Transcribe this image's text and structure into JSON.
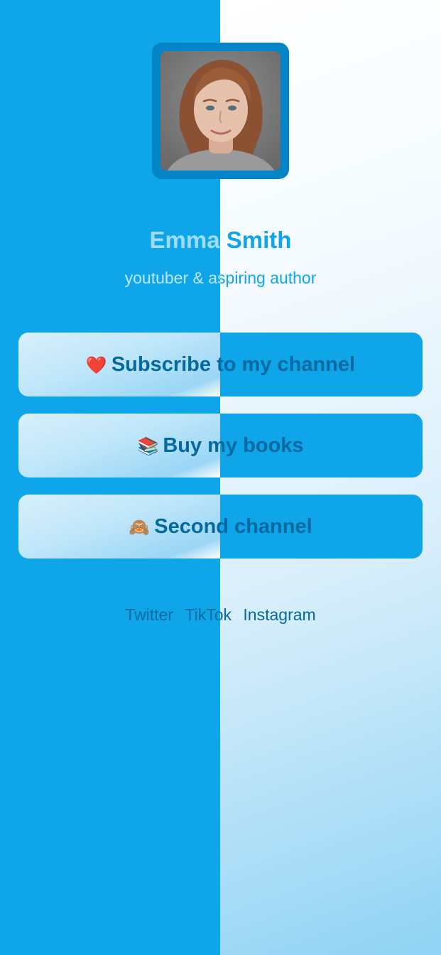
{
  "theme": {
    "left_bg": "#0ea5e9",
    "right_bg_top": "#ffffff",
    "right_bg_bottom": "#8fd3f4",
    "button_text": "#0369a1",
    "frame": "#0284c7"
  },
  "profile": {
    "name": "Emma Smith",
    "bio": "youtuber & aspiring author",
    "avatar_alt": "profile photo"
  },
  "links": [
    {
      "emoji": "❤️",
      "label": "Subscribe to my channel"
    },
    {
      "emoji": "📚",
      "label": "Buy my books"
    },
    {
      "emoji": "🙈",
      "label": "Second channel"
    }
  ],
  "socials": [
    "Twitter",
    "TikTok",
    "Instagram"
  ]
}
